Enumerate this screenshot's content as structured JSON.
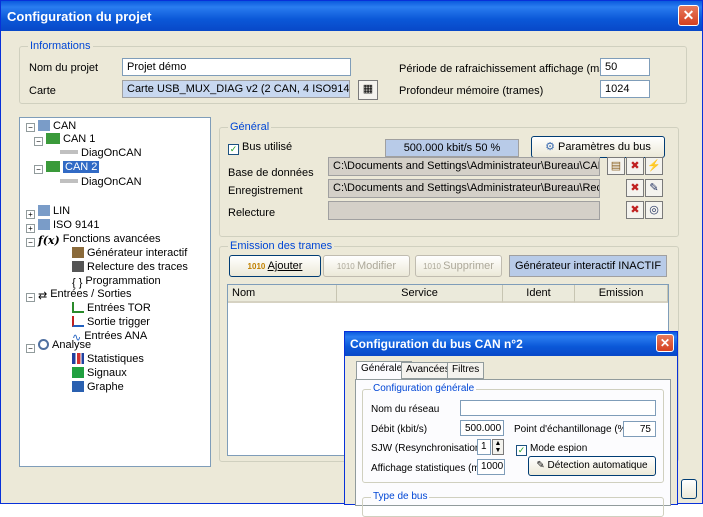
{
  "window": {
    "title": "Configuration du projet"
  },
  "info": {
    "legend": "Informations",
    "project_label": "Nom du projet",
    "project_value": "Projet démo",
    "card_label": "Carte",
    "card_value": "Carte USB_MUX_DIAG v2 (2 CAN, 4 ISO9141)",
    "refresh_label": "Période de rafraichissement affichage (ms)",
    "refresh_value": "50",
    "depth_label": "Profondeur mémoire (trames)",
    "depth_value": "1024"
  },
  "tree": {
    "can": "CAN",
    "can1": "CAN 1",
    "diag1": "DiagOnCAN",
    "can2": "CAN 2",
    "diag2": "DiagOnCAN",
    "lin": "LIN",
    "iso": "ISO 9141",
    "func": "Fonctions avancées",
    "gen": "Générateur interactif",
    "replay": "Relecture des traces",
    "prog": "Programmation",
    "io": "Entrées / Sorties",
    "tor": "Entrées TOR",
    "trig": "Sortie trigger",
    "ana": "Entrées ANA",
    "analyse": "Analyse",
    "stats": "Statistiques",
    "signaux": "Signaux",
    "graphe": "Graphe"
  },
  "general": {
    "legend": "Général",
    "bus_used": "Bus utilisé",
    "speed": "500.000 kbit/s 50 %",
    "bus_params": "Paramètres du bus",
    "db_label": "Base de données",
    "db_value": "C:\\Documents and Settings\\Administrateur\\Bureau\\CAN HS",
    "rec_label": "Enregistrement",
    "rec_value": "C:\\Documents and Settings\\Administrateur\\Bureau\\Record_",
    "replay_label": "Relecture"
  },
  "emission": {
    "legend": "Emission des trames",
    "add": "Ajouter",
    "modify": "Modifier",
    "delete": "Supprimer",
    "gen_status": "Générateur interactif INACTIF",
    "cols": [
      "Nom",
      "Service",
      "Ident",
      "Emission"
    ]
  },
  "dialog": {
    "title": "Configuration du bus CAN n°2",
    "tabs": [
      "Générales",
      "Avancées",
      "Filtres"
    ],
    "config_legend": "Configuration générale",
    "network_label": "Nom du réseau",
    "network_value": "",
    "rate_label": "Débit (kbit/s)",
    "rate_value": "500.000",
    "sample_label": "Point d'échantillonage (%)",
    "sample_value": "75",
    "sjw_label": "SJW (Resynchronisation)",
    "sjw_value": "1",
    "spy_label": "Mode espion",
    "stats_label": "Affichage statistiques (ms)",
    "stats_value": "1000",
    "autodetect": "Détection automatique",
    "bus_type_legend": "Type de bus"
  }
}
